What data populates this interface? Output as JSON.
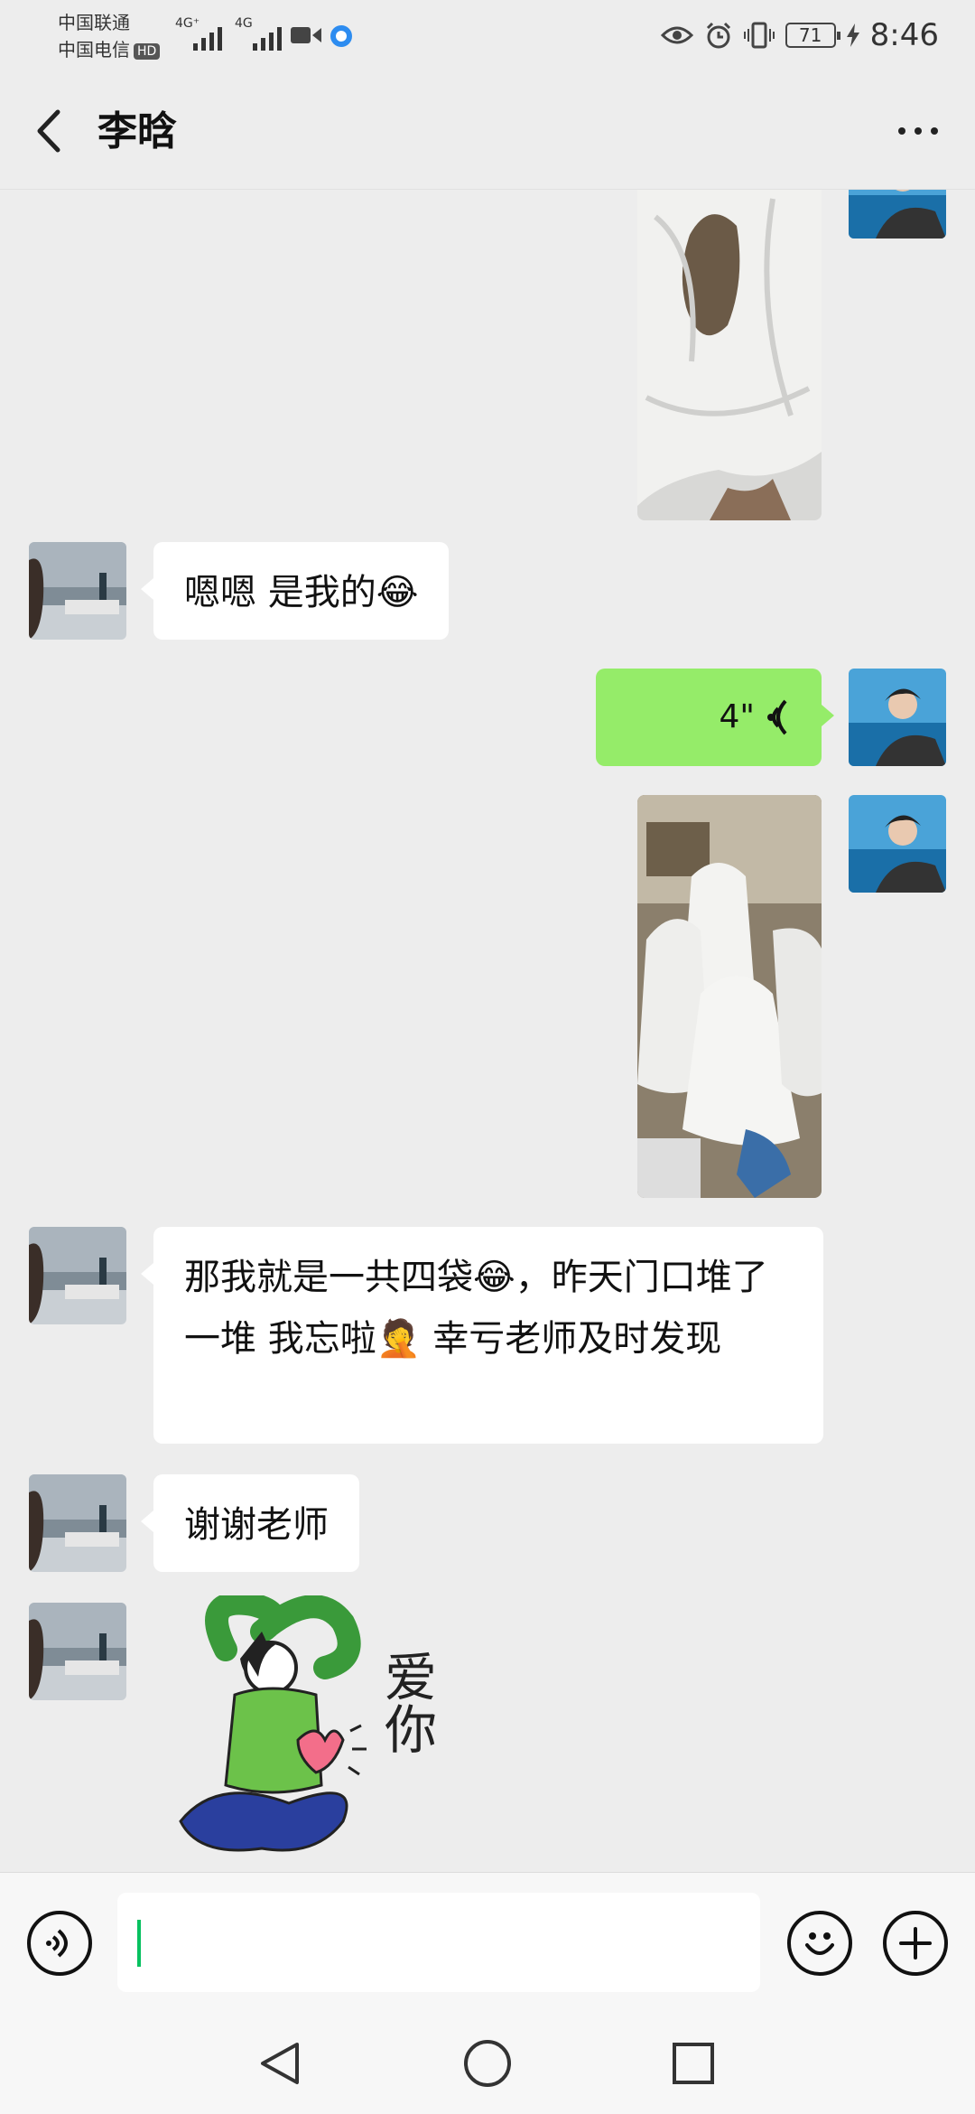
{
  "status_bar": {
    "carrier_1": "中国联通",
    "carrier_2": "中国电信",
    "hd_label": "HD",
    "signal_1_label": "4G⁺",
    "signal_2_label": "4G",
    "battery": "71",
    "time": "8:46"
  },
  "header": {
    "title": "李晗"
  },
  "messages": [
    {
      "side": "left",
      "type": "text",
      "text": "嗯嗯 是我的😂"
    },
    {
      "side": "right",
      "type": "voice",
      "duration": "4\""
    },
    {
      "side": "left",
      "type": "text",
      "text": "那我就是一共四袋😂，昨天门口堆了一堆 我忘啦🤦 幸亏老师及时发现"
    },
    {
      "side": "left",
      "type": "text",
      "text": "谢谢老师"
    },
    {
      "side": "left",
      "type": "sticker",
      "sticker_text": "爱你"
    }
  ],
  "input_bar": {
    "value": "",
    "icons": [
      "voice-icon",
      "emoji-icon",
      "plus-icon"
    ]
  },
  "nav": {
    "icons": [
      "back-triangle-icon",
      "home-circle-icon",
      "recents-square-icon"
    ]
  },
  "colors": {
    "background": "#ededed",
    "sent_bubble": "#95ec69",
    "received_bubble": "#ffffff",
    "caret": "#07c160"
  }
}
